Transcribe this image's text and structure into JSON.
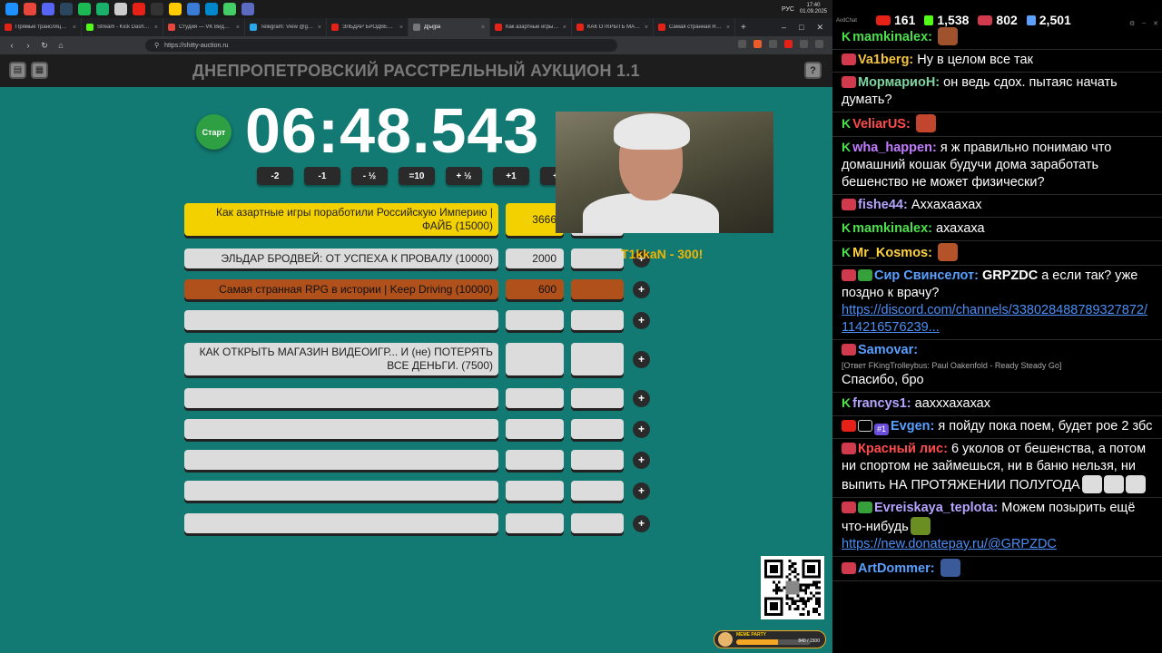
{
  "taskbar": {
    "icon_colors": [
      "#1e90ff",
      "#e8453c",
      "#5865f2",
      "#2a475e",
      "#1db954",
      "#1ab26b",
      "#ccc",
      "#e62117",
      "#333",
      "#ffcc00",
      "#3a7bd5",
      "#0088cc",
      "#44cc66",
      "#5c6bc0"
    ],
    "lang": "РУС",
    "time": "17:40",
    "date": "01.09.2025"
  },
  "browser": {
    "tabs": [
      {
        "title": "Прямые трансляции - Y",
        "color": "#e62117"
      },
      {
        "title": "Stream - Kick Dashboard",
        "color": "#53fc18"
      },
      {
        "title": "Студия — VK Видео Live",
        "color": "#e8453c"
      },
      {
        "title": "Telegram: View @grpzdc",
        "color": "#29a9eb"
      },
      {
        "title": "ЭЛЬДАР БРОДВЕЙ: ОТ",
        "color": "#e62117"
      },
      {
        "title": "Д[ы]ра",
        "color": "#777",
        "active": true
      },
      {
        "title": "Как азартные игры по...",
        "color": "#e62117"
      },
      {
        "title": "КАК ОТКРЫТЬ МАГАЗИ...",
        "color": "#e62117"
      },
      {
        "title": "Самая странная RPG в и",
        "color": "#e62117"
      }
    ],
    "url": "https://shitty-auction.ru"
  },
  "auction": {
    "title": "ДНЕПРОПЕТРОВСКИЙ РАССТРЕЛЬНЫЙ АУКЦИОН 1.1",
    "start_label": "Старт",
    "timer": "06:48.543",
    "time_buttons": [
      "-2",
      "-1",
      "- ½",
      "=10",
      "+ ½",
      "+1",
      "+2"
    ],
    "lots": [
      {
        "name": "Как азартные игры поработили Российскую Империю | ФАЙБ (15000)",
        "amount": "3666",
        "style": "gold"
      },
      {
        "name": "ЭЛЬДАР БРОДВЕЙ: ОТ УСПЕХА К ПРОВАЛУ (10000)",
        "amount": "2000",
        "style": "gray"
      },
      {
        "name": "Самая странная RPG в истории | Keep Driving (10000)",
        "amount": "600",
        "style": "brown"
      },
      {
        "name": "",
        "amount": "",
        "style": "gray"
      },
      {
        "name": "КАК ОТКРЫТЬ МАГАЗИН ВИДЕОИГР... И (не) ПОТЕРЯТЬ ВСЕ ДЕНЬГИ. (7500)",
        "amount": "",
        "style": "gray"
      },
      {
        "name": "",
        "amount": "",
        "style": "gray"
      },
      {
        "name": "",
        "amount": "",
        "style": "gray"
      },
      {
        "name": "",
        "amount": "",
        "style": "gray"
      },
      {
        "name": "",
        "amount": "",
        "style": "gray"
      },
      {
        "name": "",
        "amount": "",
        "style": "gray"
      }
    ],
    "plus_label": "+",
    "donation_alert": "T1kkaN - 300!",
    "meme_party": {
      "label": "MEME PARTY",
      "count": "840 / 1500",
      "progress": 0.56
    }
  },
  "chat": {
    "app_name": "AvdChat",
    "stats": [
      {
        "value": "161",
        "icon": "youtube-icon",
        "color": "#e62117"
      },
      {
        "value": "1,538",
        "icon": "kick-icon",
        "color": "#53fc18"
      },
      {
        "value": "802",
        "icon": "vk-live-icon",
        "color": "#d13a4c"
      },
      {
        "value": "2,501",
        "icon": "viewers-icon",
        "color": "#5aa0ff"
      }
    ],
    "messages": [
      {
        "badges": [
          "kick"
        ],
        "user": "mamkinalex:",
        "color": "#4ae04a",
        "text": "",
        "emote": "#a0522d"
      },
      {
        "badges": [
          "live"
        ],
        "user": "Va1berg:",
        "color": "#f5c542",
        "text": "Ну в целом все так"
      },
      {
        "badges": [
          "live"
        ],
        "user": "МормариоН:",
        "color": "#7fd4a0",
        "text": "он ведь сдох. пытаяс начать думать?"
      },
      {
        "badges": [
          "kick"
        ],
        "user": "VeliarUS:",
        "color": "#ff4b4b",
        "text": "",
        "emote": "#c2452d"
      },
      {
        "badges": [
          "kick"
        ],
        "user": "wha_happen:",
        "color": "#c47cff",
        "text": "я ж правильно понимаю что домашний кошак будучи дома заработать бешенство не может физически?"
      },
      {
        "badges": [
          "live"
        ],
        "user": "fishe44:",
        "color": "#b6a4ff",
        "text": "Аххахаахах"
      },
      {
        "badges": [
          "kick"
        ],
        "user": "mamkinalex:",
        "color": "#4ae04a",
        "text": "ахахаха"
      },
      {
        "badges": [
          "kick"
        ],
        "user": "Mr_Kosmos:",
        "color": "#ffd23f",
        "text": "",
        "emote": "#b4532a"
      },
      {
        "badges": [
          "live",
          "green"
        ],
        "user": "Сир Свинселот:",
        "color": "#5aa0ff",
        "text_bold": "GRPZDC",
        "text": " а если так? уже поздно к врачу?",
        "link": "https://discord.com/channels/338028488789327872/114216576239..."
      },
      {
        "badges": [
          "live"
        ],
        "user": "Samovar:",
        "color": "#5aa0ff",
        "reply": "[Ответ FKingTrolleybus: Paul Oakenfold - Ready Steady Go]",
        "text_line": "Спасибо, бро"
      },
      {
        "badges": [
          "kick"
        ],
        "user": "francys1:",
        "color": "#b6a4ff",
        "text": "аахххахахах"
      },
      {
        "badges": [
          "yt",
          "crown",
          "sub"
        ],
        "user": "Evgen:",
        "color": "#5aa0ff",
        "text": "я пойду пока поем, будет рое 2 збс"
      },
      {
        "badges": [
          "live"
        ],
        "user": "Красный лис:",
        "color": "#ff4b4b",
        "text": "6 уколов от бешенства, а потом ни спортом не займешься, ни в баню нельзя, ни выпить НА ПРОТЯЖЕНИИ ПОЛУГОДА",
        "emotes": 3
      },
      {
        "badges": [
          "live",
          "green"
        ],
        "user": "Evreiskaya_teplota:",
        "color": "#b6a4ff",
        "text": "Можем позырить ещё что-нибудь",
        "emote": "#6b8e23",
        "link": "https://new.donatepay.ru/@GRPZDC"
      },
      {
        "badges": [
          "live"
        ],
        "user": "ArtDommer:",
        "color": "#5aa0ff",
        "text": "",
        "emote": "#3a5a9a"
      }
    ]
  }
}
